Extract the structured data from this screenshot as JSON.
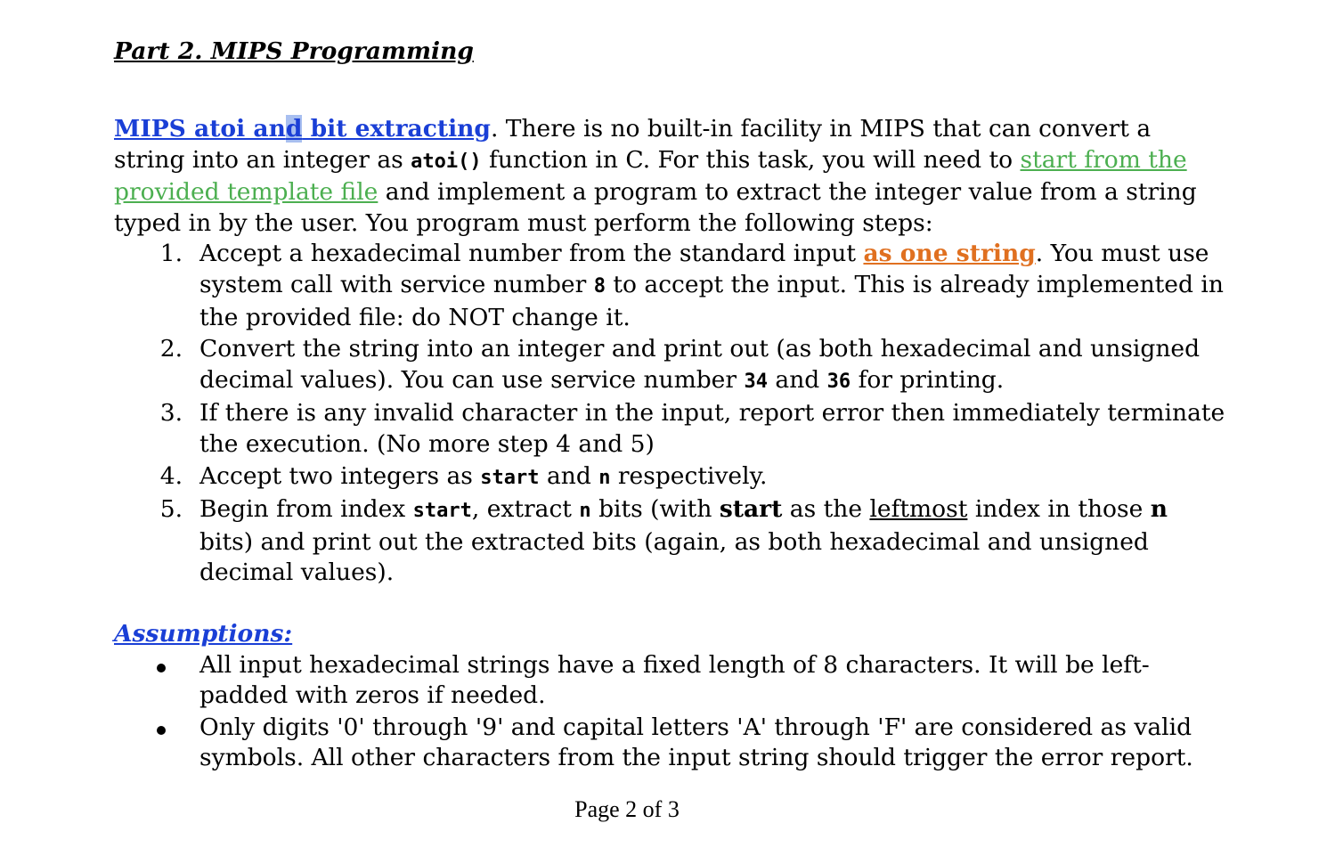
{
  "heading": "Part 2. MIPS Programming",
  "intro": {
    "title_a": "MIPS atoi an",
    "title_b": "d",
    "title_c": " bit extracting",
    "t1": ".  There is no built-in facility in MIPS that can convert a string into an integer as ",
    "atoi_code": "atoi()",
    "t2": " function in C.  For this task, you will need to ",
    "template_link": "start from the provided template file",
    "t3": " and implement a program to extract the integer value from a string typed in by the user.  You program must perform the following steps:"
  },
  "steps": {
    "s1": {
      "num": "1.",
      "a": "Accept a hexadecimal number from the standard input ",
      "link": "as one string",
      "b": ". You must use system call with service number ",
      "code": "8",
      "c": " to accept the input.  This is already implemented in the provided file: do NOT change it."
    },
    "s2": {
      "num": "2.",
      "a": "Convert the string into an integer and print out (as both hexadecimal and unsigned decimal values).  You can use service number ",
      "code1": "34",
      "b": " and ",
      "code2": "36",
      "c": " for printing."
    },
    "s3": {
      "num": "3.",
      "a": "If there is any invalid character in the input, report error then immediately terminate the execution. (No more step 4 and 5)"
    },
    "s4": {
      "num": "4.",
      "a": "Accept two integers as ",
      "code1": "start",
      "b": " and ",
      "code2": "n",
      "c": " respectively."
    },
    "s5": {
      "num": "5.",
      "a": "Begin from index ",
      "code1": "start",
      "b": ", extract ",
      "code2": "n",
      "c": " bits (with ",
      "bold1": "start",
      "d": " as the ",
      "ul": "leftmost",
      "e": " index in those ",
      "bold2": "n",
      "f": " bits) and print out the extracted bits (again, as both hexadecimal and unsigned decimal values)."
    }
  },
  "assumptions": {
    "heading": "Assumptions:",
    "a1": "All input hexadecimal strings have a fixed length of 8 characters. It will be left-padded with zeros if needed.",
    "a2": "Only digits '0' through '9' and capital letters 'A' through 'F' are considered as valid symbols. All other characters from the input string should trigger the error report."
  },
  "footer": "Page 2 of 3"
}
